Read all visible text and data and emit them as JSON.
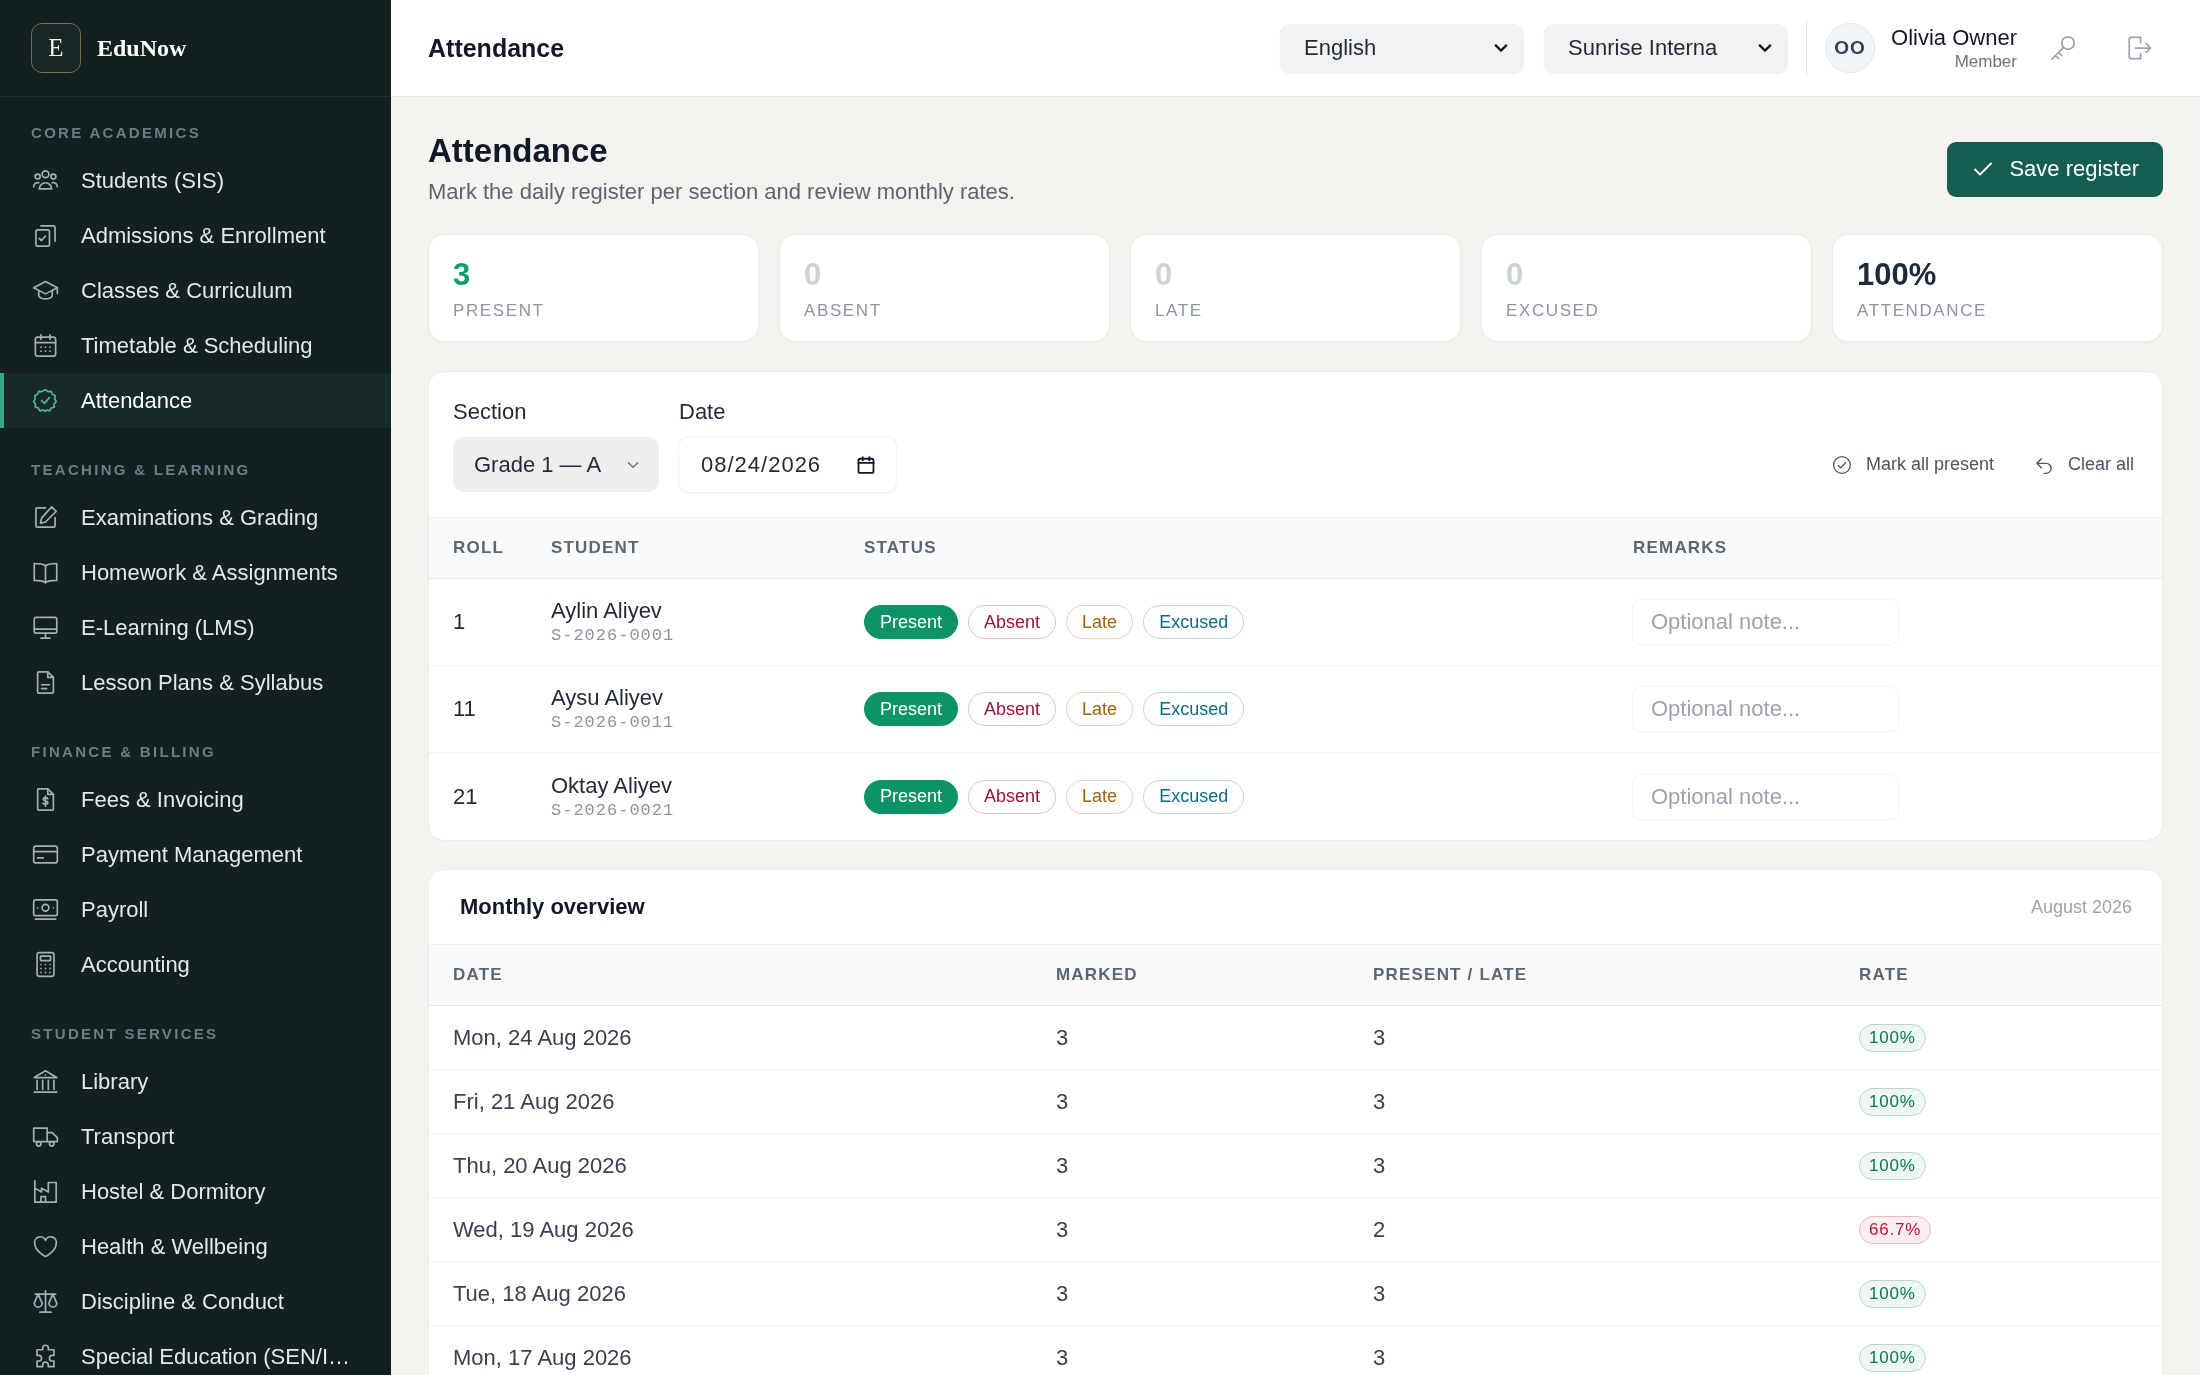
{
  "sidebar": {
    "brand": {
      "logo": "E",
      "name": "EduNow"
    },
    "sections": [
      {
        "title": "CORE ACADEMICS",
        "items": [
          {
            "label": "Students (SIS)",
            "selected": false
          },
          {
            "label": "Admissions & Enrollment",
            "selected": false
          },
          {
            "label": "Classes & Curriculum",
            "selected": false
          },
          {
            "label": "Timetable & Scheduling",
            "selected": false
          },
          {
            "label": "Attendance",
            "selected": true
          }
        ]
      },
      {
        "title": "TEACHING & LEARNING",
        "items": [
          {
            "label": "Examinations & Grading",
            "selected": false
          },
          {
            "label": "Homework & Assignments",
            "selected": false
          },
          {
            "label": "E-Learning (LMS)",
            "selected": false
          },
          {
            "label": "Lesson Plans & Syllabus",
            "selected": false
          }
        ]
      },
      {
        "title": "FINANCE & BILLING",
        "items": [
          {
            "label": "Fees & Invoicing",
            "selected": false
          },
          {
            "label": "Payment Management",
            "selected": false
          },
          {
            "label": "Payroll",
            "selected": false
          },
          {
            "label": "Accounting",
            "selected": false
          }
        ]
      },
      {
        "title": "STUDENT SERVICES",
        "items": [
          {
            "label": "Library",
            "selected": false
          },
          {
            "label": "Transport",
            "selected": false
          },
          {
            "label": "Hostel & Dormitory",
            "selected": false
          },
          {
            "label": "Health & Wellbeing",
            "selected": false
          },
          {
            "label": "Discipline & Conduct",
            "selected": false
          },
          {
            "label": "Special Education (SEN/I…",
            "selected": false
          }
        ]
      }
    ]
  },
  "header": {
    "title": "Attendance",
    "language": "English",
    "school": "Sunrise Interna",
    "user": {
      "initials": "OO",
      "name": "Olivia Owner",
      "role": "Member"
    }
  },
  "page": {
    "title": "Attendance",
    "subtitle": "Mark the daily register per section and review monthly rates.",
    "save_button": "Save register"
  },
  "stats": [
    {
      "value": "3",
      "label": "PRESENT",
      "color": "#0f9b6c"
    },
    {
      "value": "0",
      "label": "ABSENT",
      "color": "#cbd2da"
    },
    {
      "value": "0",
      "label": "LATE",
      "color": "#cbd2da"
    },
    {
      "value": "0",
      "label": "EXCUSED",
      "color": "#cbd2da"
    },
    {
      "value": "100%",
      "label": "ATTENDANCE",
      "color": "#1e293b"
    }
  ],
  "register": {
    "filters": [
      {
        "kind": "select",
        "label": "Section",
        "value": "Grade 1 — A"
      },
      {
        "kind": "date",
        "label": "Date",
        "value": "08/24/2026"
      }
    ],
    "actions": [
      "Mark all present",
      "Clear all"
    ],
    "columns": [
      "ROLL",
      "STUDENT",
      "STATUS",
      "REMARKS"
    ],
    "rows": [
      {
        "roll": "1",
        "name": "Aylin Aliyev",
        "student_id": "S-2026-0001",
        "statuses": [
          {
            "label": "Present",
            "selected": true,
            "color": "#0c9467"
          },
          {
            "label": "Absent",
            "selected": false,
            "color": "#9f1239"
          },
          {
            "label": "Late",
            "selected": false,
            "color": "#a1620b"
          },
          {
            "label": "Excused",
            "selected": false,
            "color": "#0e6a8a"
          }
        ],
        "remarks_placeholder": "Optional note..."
      },
      {
        "roll": "11",
        "name": "Aysu Aliyev",
        "student_id": "S-2026-0011",
        "statuses": [
          {
            "label": "Present",
            "selected": true,
            "color": "#0c9467"
          },
          {
            "label": "Absent",
            "selected": false,
            "color": "#9f1239"
          },
          {
            "label": "Late",
            "selected": false,
            "color": "#a1620b"
          },
          {
            "label": "Excused",
            "selected": false,
            "color": "#0e6a8a"
          }
        ],
        "remarks_placeholder": "Optional note..."
      },
      {
        "roll": "21",
        "name": "Oktay Aliyev",
        "student_id": "S-2026-0021",
        "statuses": [
          {
            "label": "Present",
            "selected": true,
            "color": "#0c9467"
          },
          {
            "label": "Absent",
            "selected": false,
            "color": "#9f1239"
          },
          {
            "label": "Late",
            "selected": false,
            "color": "#a1620b"
          },
          {
            "label": "Excused",
            "selected": false,
            "color": "#0e6a8a"
          }
        ],
        "remarks_placeholder": "Optional note..."
      }
    ]
  },
  "monthly": {
    "title": "Monthly overview",
    "period": "August 2026",
    "columns": [
      "DATE",
      "MARKED",
      "PRESENT / LATE",
      "RATE"
    ],
    "rows": [
      {
        "date": "Mon, 24 Aug 2026",
        "marked": "3",
        "present_late": "3",
        "rate": "100%",
        "color": "#047857"
      },
      {
        "date": "Fri, 21 Aug 2026",
        "marked": "3",
        "present_late": "3",
        "rate": "100%",
        "color": "#047857"
      },
      {
        "date": "Thu, 20 Aug 2026",
        "marked": "3",
        "present_late": "3",
        "rate": "100%",
        "color": "#047857"
      },
      {
        "date": "Wed, 19 Aug 2026",
        "marked": "3",
        "present_late": "2",
        "rate": "66.7%",
        "color": "#be123c"
      },
      {
        "date": "Tue, 18 Aug 2026",
        "marked": "3",
        "present_late": "3",
        "rate": "100%",
        "color": "#047857"
      },
      {
        "date": "Mon, 17 Aug 2026",
        "marked": "3",
        "present_late": "3",
        "rate": "100%",
        "color": "#047857"
      }
    ]
  }
}
